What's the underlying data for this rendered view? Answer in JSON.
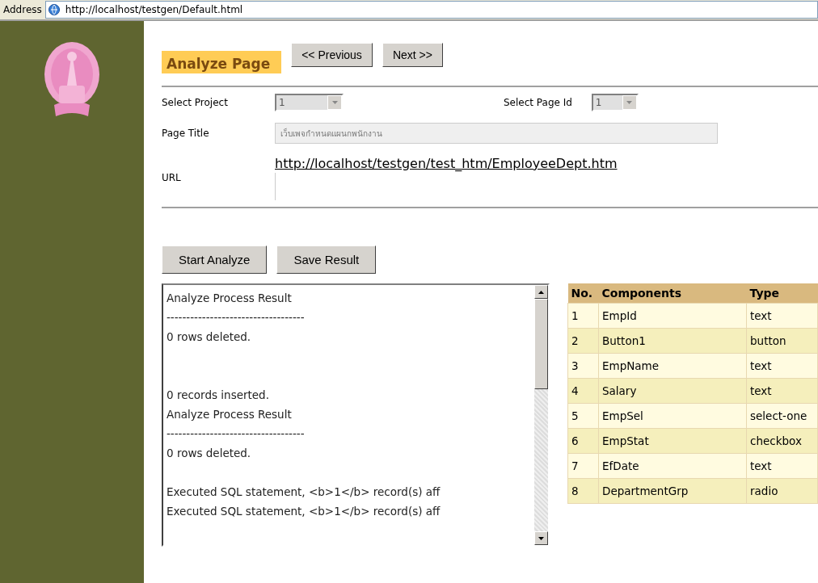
{
  "address_bar": {
    "label": "Address",
    "url": "http://localhost/testgen/Default.html"
  },
  "header": {
    "title": "Analyze Page",
    "buttons": [
      "<< Previous",
      "Next >>"
    ]
  },
  "form": {
    "project": {
      "label": "Select Project",
      "value": "1",
      "disabled": true
    },
    "page_id": {
      "label": "Select Page Id",
      "value": "1",
      "disabled": true
    },
    "page_title": {
      "label": "Page Title",
      "value": "เว็บเพจกำหนดแผนกพนักงาน",
      "disabled": true
    },
    "url": {
      "label": "URL",
      "link": "http://localhost/testgen/test_htm/EmployeeDept.htm"
    }
  },
  "actions": [
    "Start Analyze",
    "Save Result"
  ],
  "result_log": {
    "value": "Analyze Process Result\n-----------------------------------\n0 rows deleted.\n\n\n0 records inserted.\nAnalyze Process Result\n-----------------------------------\n0 rows deleted.\n\nExecuted SQL statement, <b>1</b> record(s) aff\nExecuted SQL statement, <b>1</b> record(s) aff"
  },
  "table": {
    "columns": [
      "No.",
      "Components",
      "Type"
    ],
    "rows": [
      [
        "1",
        "EmpId",
        "text"
      ],
      [
        "2",
        "Button1",
        "button"
      ],
      [
        "3",
        "EmpName",
        "text"
      ],
      [
        "4",
        "Salary",
        "text"
      ],
      [
        "5",
        "EmpSel",
        "select-one"
      ],
      [
        "6",
        "EmpStat",
        "checkbox"
      ],
      [
        "7",
        "EfDate",
        "text"
      ],
      [
        "8",
        "DepartmentGrp",
        "radio"
      ]
    ]
  }
}
